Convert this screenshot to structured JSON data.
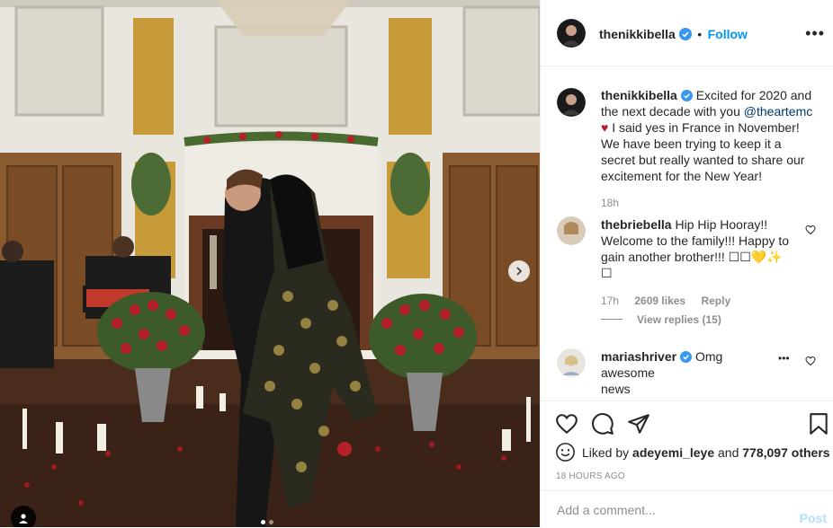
{
  "photo": {
    "alt_icon": "person-tag-icon"
  },
  "header": {
    "username": "thenikkibella",
    "follow_separator": "•",
    "follow_label": "Follow",
    "more_label": "•••"
  },
  "caption": {
    "username": "thenikkibella",
    "text_1": "Excited for 2020 and the next decade with you ",
    "mention": "@theartemc",
    "heart": "♥",
    "text_2": " I said yes in France in November! We have been trying to keep it a secret but really wanted to share our excitement for the New Year!",
    "time": "18h"
  },
  "comments": [
    {
      "username": "thebriebella",
      "text": "Hip Hip Hooray!! Welcome to the family!!! Happy to gain another brother!!! ☐☐💛✨",
      "text_2": "☐",
      "time": "17h",
      "likes": "2609 likes",
      "reply": "Reply",
      "view_replies": "View replies (15)"
    },
    {
      "username": "mariashriver",
      "text": "Omg awesome",
      "text_2": "news",
      "more": "•••"
    }
  ],
  "actions": {
    "liked_by_prefix": "Liked by ",
    "liked_by_user": "adeyemi_leye",
    "liked_by_and": " and ",
    "liked_by_count": "778,097 others",
    "time_ago": "18 HOURS AGO"
  },
  "add_comment": {
    "placeholder": "Add a comment...",
    "post_label": "Post"
  },
  "colors": {
    "accent": "#0095f6",
    "verified": "#3897f0",
    "muted": "#8e8e8e",
    "post_disabled": "#b2dffc"
  }
}
